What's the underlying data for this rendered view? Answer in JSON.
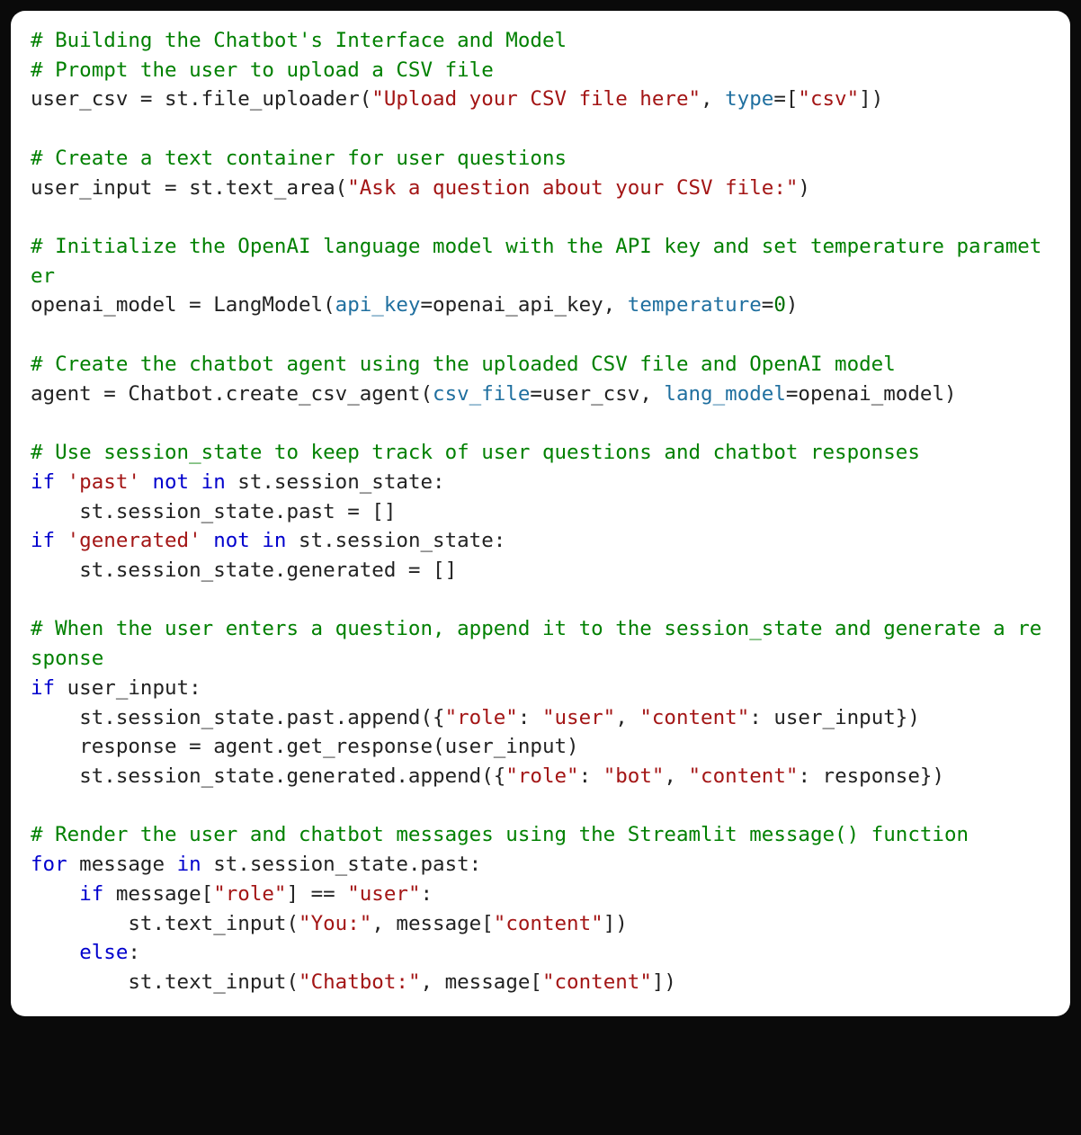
{
  "code": {
    "tokens": [
      {
        "cls": "tok-comment",
        "text": "# Building the Chatbot's Interface and Model\n"
      },
      {
        "cls": "tok-comment",
        "text": "# Prompt the user to upload a CSV file\n"
      },
      {
        "cls": "tok-default",
        "text": "user_csv = st.file_uploader("
      },
      {
        "cls": "tok-string",
        "text": "\"Upload your CSV file here\""
      },
      {
        "cls": "tok-default",
        "text": ", "
      },
      {
        "cls": "tok-param",
        "text": "type"
      },
      {
        "cls": "tok-default",
        "text": "=["
      },
      {
        "cls": "tok-string",
        "text": "\"csv\""
      },
      {
        "cls": "tok-default",
        "text": "])\n"
      },
      {
        "cls": "tok-default",
        "text": "\n"
      },
      {
        "cls": "tok-comment",
        "text": "# Create a text container for user questions\n"
      },
      {
        "cls": "tok-default",
        "text": "user_input = st.text_area("
      },
      {
        "cls": "tok-string",
        "text": "\"Ask a question about your CSV file:\""
      },
      {
        "cls": "tok-default",
        "text": ")\n"
      },
      {
        "cls": "tok-default",
        "text": "\n"
      },
      {
        "cls": "tok-comment",
        "text": "# Initialize the OpenAI language model with the API key and set temperature parameter\n"
      },
      {
        "cls": "tok-default",
        "text": "openai_model = LangModel("
      },
      {
        "cls": "tok-param",
        "text": "api_key"
      },
      {
        "cls": "tok-default",
        "text": "=openai_api_key, "
      },
      {
        "cls": "tok-param",
        "text": "temperature"
      },
      {
        "cls": "tok-default",
        "text": "="
      },
      {
        "cls": "tok-number",
        "text": "0"
      },
      {
        "cls": "tok-default",
        "text": ")\n"
      },
      {
        "cls": "tok-default",
        "text": "\n"
      },
      {
        "cls": "tok-comment",
        "text": "# Create the chatbot agent using the uploaded CSV file and OpenAI model\n"
      },
      {
        "cls": "tok-default",
        "text": "agent = Chatbot.create_csv_agent("
      },
      {
        "cls": "tok-param",
        "text": "csv_file"
      },
      {
        "cls": "tok-default",
        "text": "=user_csv, "
      },
      {
        "cls": "tok-param",
        "text": "lang_model"
      },
      {
        "cls": "tok-default",
        "text": "=openai_model)\n"
      },
      {
        "cls": "tok-default",
        "text": "\n"
      },
      {
        "cls": "tok-comment",
        "text": "# Use session_state to keep track of user questions and chatbot responses\n"
      },
      {
        "cls": "tok-keyword",
        "text": "if"
      },
      {
        "cls": "tok-default",
        "text": " "
      },
      {
        "cls": "tok-string",
        "text": "'past'"
      },
      {
        "cls": "tok-default",
        "text": " "
      },
      {
        "cls": "tok-keyword",
        "text": "not in"
      },
      {
        "cls": "tok-default",
        "text": " st.session_state:\n"
      },
      {
        "cls": "tok-default",
        "text": "    st.session_state.past = []\n"
      },
      {
        "cls": "tok-keyword",
        "text": "if"
      },
      {
        "cls": "tok-default",
        "text": " "
      },
      {
        "cls": "tok-string",
        "text": "'generated'"
      },
      {
        "cls": "tok-default",
        "text": " "
      },
      {
        "cls": "tok-keyword",
        "text": "not in"
      },
      {
        "cls": "tok-default",
        "text": " st.session_state:\n"
      },
      {
        "cls": "tok-default",
        "text": "    st.session_state.generated = []\n"
      },
      {
        "cls": "tok-default",
        "text": "\n"
      },
      {
        "cls": "tok-comment",
        "text": "# When the user enters a question, append it to the session_state and generate a response\n"
      },
      {
        "cls": "tok-keyword",
        "text": "if"
      },
      {
        "cls": "tok-default",
        "text": " user_input:\n"
      },
      {
        "cls": "tok-default",
        "text": "    st.session_state.past.append({"
      },
      {
        "cls": "tok-string",
        "text": "\"role\""
      },
      {
        "cls": "tok-default",
        "text": ": "
      },
      {
        "cls": "tok-string",
        "text": "\"user\""
      },
      {
        "cls": "tok-default",
        "text": ", "
      },
      {
        "cls": "tok-string",
        "text": "\"content\""
      },
      {
        "cls": "tok-default",
        "text": ": user_input})\n"
      },
      {
        "cls": "tok-default",
        "text": "    response = agent.get_response(user_input)\n"
      },
      {
        "cls": "tok-default",
        "text": "    st.session_state.generated.append({"
      },
      {
        "cls": "tok-string",
        "text": "\"role\""
      },
      {
        "cls": "tok-default",
        "text": ": "
      },
      {
        "cls": "tok-string",
        "text": "\"bot\""
      },
      {
        "cls": "tok-default",
        "text": ", "
      },
      {
        "cls": "tok-string",
        "text": "\"content\""
      },
      {
        "cls": "tok-default",
        "text": ": response})\n"
      },
      {
        "cls": "tok-default",
        "text": "\n"
      },
      {
        "cls": "tok-comment",
        "text": "# Render the user and chatbot messages using the Streamlit message() function\n"
      },
      {
        "cls": "tok-keyword",
        "text": "for"
      },
      {
        "cls": "tok-default",
        "text": " message "
      },
      {
        "cls": "tok-keyword",
        "text": "in"
      },
      {
        "cls": "tok-default",
        "text": " st.session_state.past:\n"
      },
      {
        "cls": "tok-default",
        "text": "    "
      },
      {
        "cls": "tok-keyword",
        "text": "if"
      },
      {
        "cls": "tok-default",
        "text": " message["
      },
      {
        "cls": "tok-string",
        "text": "\"role\""
      },
      {
        "cls": "tok-default",
        "text": "] == "
      },
      {
        "cls": "tok-string",
        "text": "\"user\""
      },
      {
        "cls": "tok-default",
        "text": ":\n"
      },
      {
        "cls": "tok-default",
        "text": "        st.text_input("
      },
      {
        "cls": "tok-string",
        "text": "\"You:\""
      },
      {
        "cls": "tok-default",
        "text": ", message["
      },
      {
        "cls": "tok-string",
        "text": "\"content\""
      },
      {
        "cls": "tok-default",
        "text": "])\n"
      },
      {
        "cls": "tok-default",
        "text": "    "
      },
      {
        "cls": "tok-keyword",
        "text": "else"
      },
      {
        "cls": "tok-default",
        "text": ":\n"
      },
      {
        "cls": "tok-default",
        "text": "        st.text_input("
      },
      {
        "cls": "tok-string",
        "text": "\"Chatbot:\""
      },
      {
        "cls": "tok-default",
        "text": ", message["
      },
      {
        "cls": "tok-string",
        "text": "\"content\""
      },
      {
        "cls": "tok-default",
        "text": "])"
      }
    ]
  }
}
